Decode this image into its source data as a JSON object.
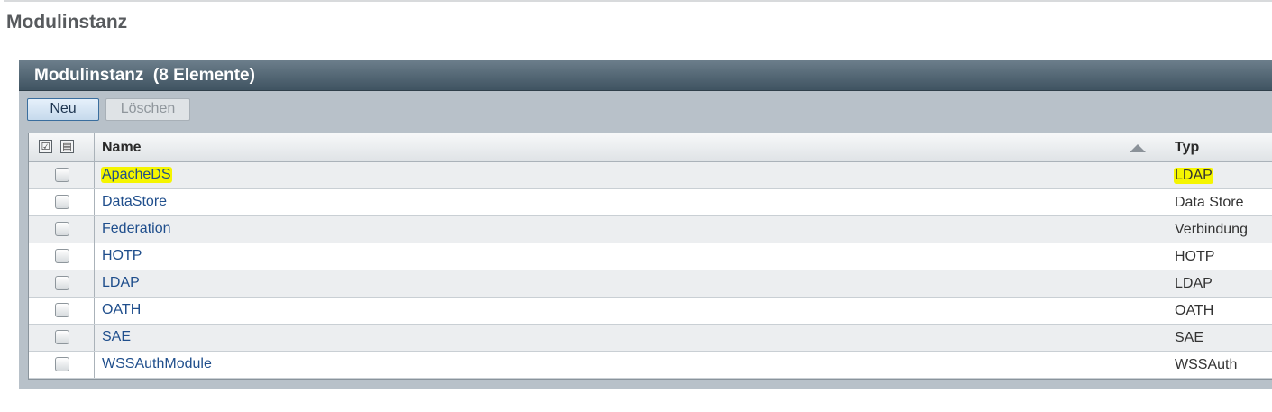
{
  "page": {
    "title": "Modulinstanz"
  },
  "panel": {
    "title": "Modulinstanz  (8 Elemente)",
    "buttons": {
      "new_label": "Neu",
      "delete_label": "Löschen"
    }
  },
  "table": {
    "select_all_icon": "select-all-icon",
    "deselect_all_icon": "deselect-all-icon",
    "columns": [
      "Name",
      "Typ"
    ],
    "sort": {
      "column": "Name",
      "direction": "ascending"
    },
    "rows": [
      {
        "name": "ApacheDS",
        "type": "LDAP",
        "highlighted": true
      },
      {
        "name": "DataStore",
        "type": "Data Store",
        "highlighted": false
      },
      {
        "name": "Federation",
        "type": "Verbindung",
        "highlighted": false
      },
      {
        "name": "HOTP",
        "type": "HOTP",
        "highlighted": false
      },
      {
        "name": "LDAP",
        "type": "LDAP",
        "highlighted": false
      },
      {
        "name": "OATH",
        "type": "OATH",
        "highlighted": false
      },
      {
        "name": "SAE",
        "type": "SAE",
        "highlighted": false
      },
      {
        "name": "WSSAuthModule",
        "type": "WSSAuth",
        "highlighted": false
      }
    ]
  },
  "colors": {
    "header_bar": "#4a5d6b",
    "link": "#1f4e8c",
    "highlight": "#f5f500"
  }
}
